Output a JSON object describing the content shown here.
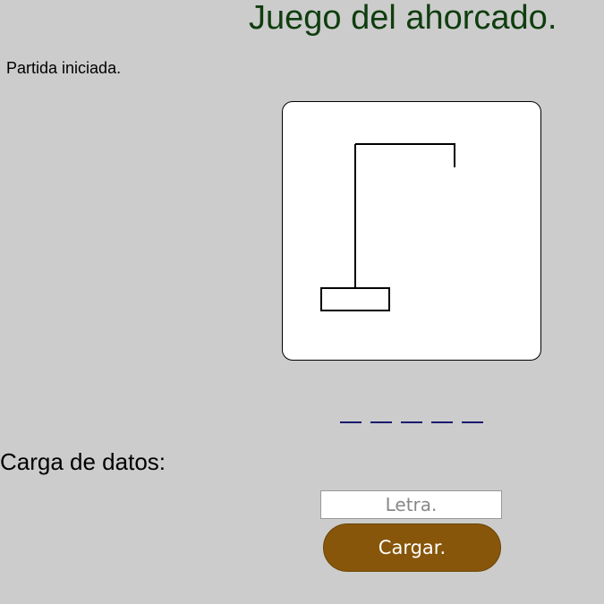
{
  "title": "Juego del ahorcado.",
  "status": "Partida iniciada.",
  "game": {
    "errors": 0,
    "word_slots": [
      "",
      "",
      "",
      "",
      ""
    ],
    "stroke_color": "#000000",
    "slot_color": "#1a1a6e"
  },
  "form": {
    "section_label": "Carga de datos:",
    "letter_placeholder": "Letra.",
    "letter_value": "",
    "submit_label": "Cargar."
  },
  "colors": {
    "background": "#cccccc",
    "title": "#0f3d0f",
    "button": "#87560a",
    "button_text": "#ffffff"
  }
}
